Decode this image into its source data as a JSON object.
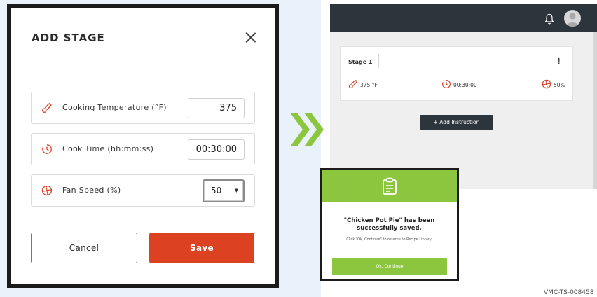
{
  "modal": {
    "title": "ADD STAGE",
    "fields": [
      {
        "icon": "thermometer-icon",
        "label": "Cooking Temperature (°F)",
        "value": "375"
      },
      {
        "icon": "clock-icon",
        "label": "Cook Time (hh:mm:ss)",
        "value": "00:30:00"
      },
      {
        "icon": "fan-icon",
        "label": "Fan Speed (%)",
        "value": "50"
      }
    ],
    "cancel_label": "Cancel",
    "save_label": "Save"
  },
  "app": {
    "stage": {
      "name": "Stage 1",
      "temperature": "375 °F",
      "time": "00:30:00",
      "fan": "50%"
    },
    "add_instruction_label": "+ Add Instruction"
  },
  "saved_dialog": {
    "title": "\"Chicken Pot Pie\" has been successfully saved.",
    "subtitle": "Click \"Ok, Continue\" to resume to Recipe Library.",
    "ok_label": "Ok, Continue"
  },
  "footer_ref": "VMC-TS-008458",
  "colors": {
    "accent_red": "#dc4122",
    "accent_green": "#8cc63f",
    "topbar": "#2d353c"
  }
}
